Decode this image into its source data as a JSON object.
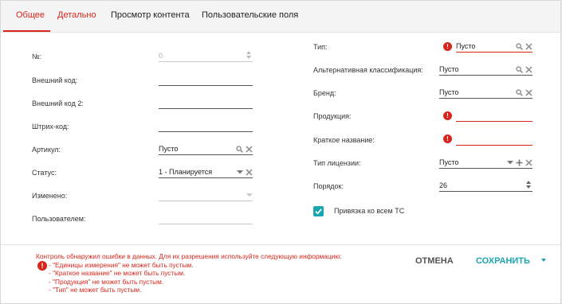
{
  "tabs": [
    "Общее",
    "Детально",
    "Просмотр контента",
    "Пользовательские поля"
  ],
  "left_fields": {
    "number": {
      "label": "№:",
      "value": "0"
    },
    "external_code": {
      "label": "Внешний код:",
      "value": ""
    },
    "external_code_2": {
      "label": "Внешний код 2:",
      "value": ""
    },
    "barcode": {
      "label": "Штрих-код:",
      "value": ""
    },
    "article": {
      "label": "Артикул:",
      "value": "Пусто"
    },
    "status": {
      "label": "Статус:",
      "value": "1 - Планируется"
    },
    "modified": {
      "label": "Изменено:",
      "value": ""
    },
    "user": {
      "label": "Пользователем:",
      "value": ""
    }
  },
  "right_fields": {
    "type": {
      "label": "Тип:",
      "value": "Пусто"
    },
    "alt_classification": {
      "label": "Альтернативная классификация:",
      "value": "Пусто"
    },
    "brand": {
      "label": "Бренд:",
      "value": "Пусто"
    },
    "product": {
      "label": "Продукция:",
      "value": ""
    },
    "short_name": {
      "label": "Краткое название:",
      "value": ""
    },
    "license_type": {
      "label": "Тип лицензии:",
      "value": "Пусто"
    },
    "order": {
      "label": "Порядок:",
      "value": "26"
    }
  },
  "checkbox": {
    "label": "Привязка ко всем ТС",
    "checked": true
  },
  "errors": {
    "header": "Контроль обнаружил ошибки в данных. Для их разрешения используйте следующую информацию:",
    "lines": [
      "- \"Единицы измерения\" не может быть пустым.",
      "- \"Краткое название\" не может быть пустым.",
      "- \"Продукция\" не может быть пустым.",
      "- \"Тип\" не может быть пустым."
    ]
  },
  "buttons": {
    "cancel": "ОТМЕНА",
    "save": "СОХРАНИТЬ"
  },
  "colors": {
    "accent_red": "#d9261c",
    "accent_teal": "#1aa5b0"
  },
  "icons": [
    "search-icon",
    "clear-icon",
    "dropdown-icon",
    "add-icon",
    "spinner-icon",
    "error-icon",
    "checkbox-checked-icon"
  ]
}
